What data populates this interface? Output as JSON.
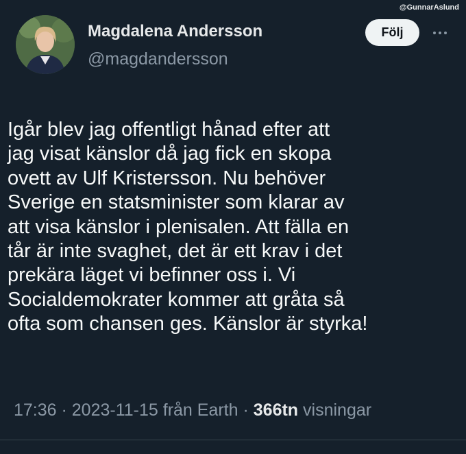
{
  "watermark": "@GunnarAslund",
  "author": {
    "name": "Magdalena Andersson",
    "handle": "@magdandersson"
  },
  "follow_label": "Följ",
  "tweet_lines": [
    "Igår blev jag offentligt hånad efter att",
    "jag visat känslor då jag fick en skopa",
    "ovett av Ulf Kristersson. Nu behöver",
    "Sverige en statsminister som klarar av",
    "att visa känslor i plenisalen. Att fälla en",
    "tår är inte svaghet, det är ett krav i det",
    "prekära läget vi befinner oss i. Vi",
    "Socialdemokrater kommer att gråta så",
    "ofta som chansen ges. Känslor är styrka!"
  ],
  "meta": {
    "time": "17:36",
    "sep1": " · ",
    "date": "2023-11-15",
    "source": " från Earth",
    "sep2": " · ",
    "views": "366tn",
    "views_label": " visningar"
  },
  "icons": {
    "more": "more-horizontal-icon"
  }
}
